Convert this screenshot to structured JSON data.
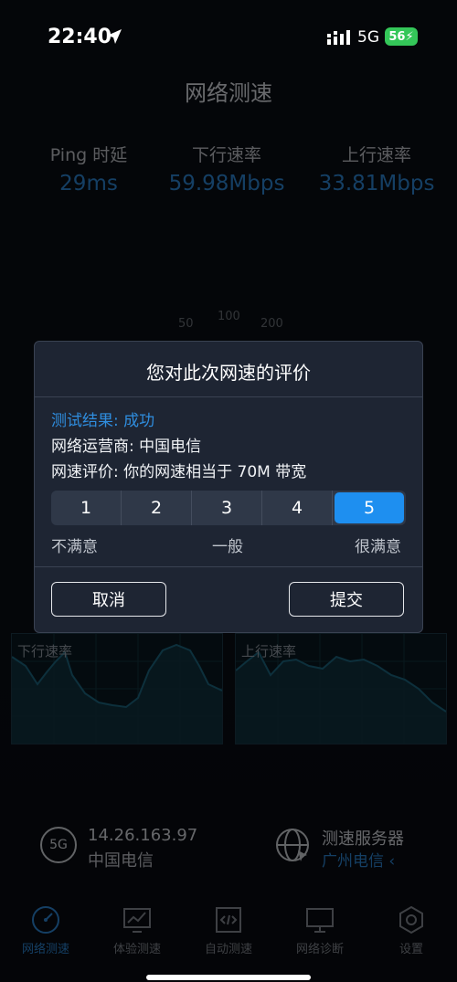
{
  "status_bar": {
    "time": "22:40",
    "network": "5G",
    "battery": "56"
  },
  "header": {
    "title": "网络测速"
  },
  "stats": [
    {
      "label": "Ping 时延",
      "value": "29ms"
    },
    {
      "label": "下行速率",
      "value": "59.98Mbps"
    },
    {
      "label": "上行速率",
      "value": "33.81Mbps"
    }
  ],
  "gauge": {
    "ticks": [
      "50",
      "100",
      "200"
    ]
  },
  "charts": {
    "download_label": "下行速率",
    "upload_label": "上行速率"
  },
  "info": {
    "network_badge": "5G",
    "ip": "14.26.163.97",
    "carrier": "中国电信",
    "server_title": "测速服务器",
    "server_name": "广州电信 ‹"
  },
  "tabs": [
    {
      "label": "网络测速",
      "icon": "speedometer-icon",
      "active": true
    },
    {
      "label": "体验测速",
      "icon": "monitor-chart-icon",
      "active": false
    },
    {
      "label": "自动测速",
      "icon": "code-file-icon",
      "active": false
    },
    {
      "label": "网络诊断",
      "icon": "desktop-icon",
      "active": false
    },
    {
      "label": "设置",
      "icon": "gear-icon",
      "active": false
    }
  ],
  "dialog": {
    "title": "您对此次网速的评价",
    "result": "测试结果: 成功",
    "operator": "网络运营商: 中国电信",
    "evaluation": "网速评价: 你的网速相当于 70M 带宽",
    "ratings": [
      "1",
      "2",
      "3",
      "4",
      "5"
    ],
    "selected_rating": 5,
    "scale_low": "不满意",
    "scale_mid": "一般",
    "scale_high": "很满意",
    "cancel_label": "取消",
    "submit_label": "提交"
  },
  "colors": {
    "accent": "#1e8ff0",
    "battery": "#34c759"
  }
}
